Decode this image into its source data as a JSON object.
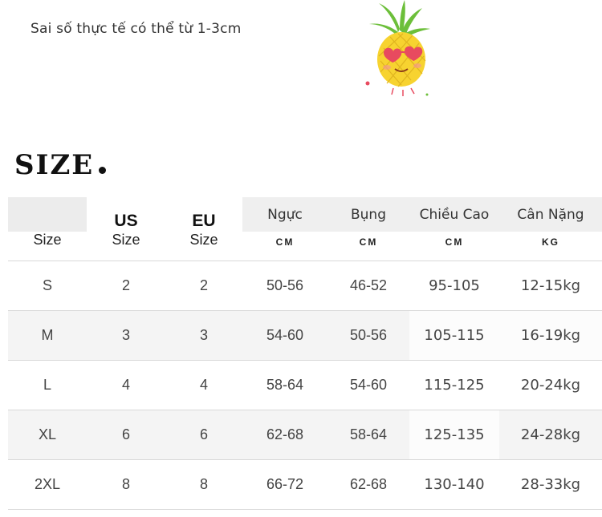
{
  "note": "Sai số thực tế có thể từ 1-3cm",
  "title": "SIZE",
  "header": {
    "us": "US",
    "eu": "EU",
    "chest": "Ngực",
    "belly": "Bụng",
    "height": "Chiều Cao",
    "weight": "Cân Nặng",
    "size_label": "Size",
    "us_sub": "Size",
    "eu_sub": "Size",
    "chest_unit": "CM",
    "belly_unit": "CM",
    "height_unit": "CM",
    "weight_unit": "KG"
  },
  "rows": [
    {
      "size": "S",
      "us": "2",
      "eu": "2",
      "chest": "50-56",
      "belly": "46-52",
      "height": "95-105",
      "weight": "12-15kg"
    },
    {
      "size": "M",
      "us": "3",
      "eu": "3",
      "chest": "54-60",
      "belly": "50-56",
      "height": "105-115",
      "weight": "16-19kg"
    },
    {
      "size": "L",
      "us": "4",
      "eu": "4",
      "chest": "58-64",
      "belly": "54-60",
      "height": "115-125",
      "weight": "20-24kg"
    },
    {
      "size": "XL",
      "us": "6",
      "eu": "6",
      "chest": "62-68",
      "belly": "58-64",
      "height": "125-135",
      "weight": "24-28kg"
    },
    {
      "size": "2XL",
      "us": "8",
      "eu": "8",
      "chest": "66-72",
      "belly": "62-68",
      "height": "130-140",
      "weight": "28-33kg"
    }
  ],
  "icons": {
    "mascot": "pineapple-with-sunglasses-icon"
  },
  "colors": {
    "header_bg": "#efefef",
    "row_alt_bg": "#f4f4f4",
    "pineapple": "#f7d330",
    "leaves": "#6cbf3a"
  }
}
